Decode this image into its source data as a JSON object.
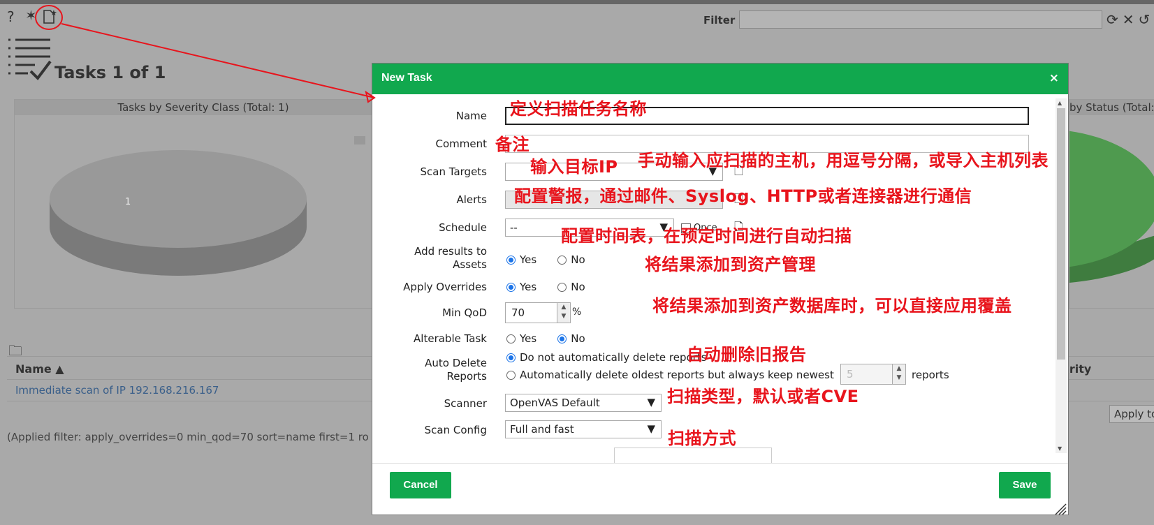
{
  "toolbar": {
    "help_icon": "help-icon",
    "wizard_icon": "wizard-icon",
    "new_task_icon": "new-task-icon"
  },
  "filter": {
    "label": "Filter",
    "value": ""
  },
  "page": {
    "title": "Tasks 1 of 1"
  },
  "charts": {
    "left_title": "Tasks by Severity Class (Total: 1)",
    "right_title": "by Status (Total:",
    "pie_label": "1"
  },
  "chart_data": [
    {
      "type": "pie",
      "title": "Tasks by Severity Class (Total: 1)",
      "categories": [
        ""
      ],
      "values": [
        1
      ]
    }
  ],
  "table": {
    "col_name": "Name ▲",
    "col_severity": "erity",
    "rows": [
      {
        "name": "Immediate scan of IP 192.168.216.167"
      }
    ],
    "apply_label": "Apply to"
  },
  "applied_filter": "(Applied filter: apply_overrides=0 min_qod=70 sort=name first=1 ro",
  "dialog": {
    "title": "New Task",
    "close": "×",
    "fields": {
      "name": "Name",
      "comment": "Comment",
      "scan_targets": "Scan Targets",
      "alerts": "Alerts",
      "schedule": "Schedule",
      "add_results_1": "Add results to",
      "add_results_2": "Assets",
      "apply_overrides": "Apply Overrides",
      "min_qod": "Min QoD",
      "alterable": "Alterable Task",
      "auto_delete_1": "Auto Delete",
      "auto_delete_2": "Reports",
      "scanner": "Scanner",
      "scan_config": "Scan Config"
    },
    "values": {
      "name": "",
      "comment": "",
      "scan_targets": "",
      "schedule": "--",
      "schedule_once": "Once",
      "min_qod": "70",
      "min_qod_unit": "%",
      "keep_newest": "5",
      "scanner": "OpenVAS Default",
      "scan_config": "Full and fast"
    },
    "radios": {
      "yes": "Yes",
      "no": "No",
      "auto_delete_none": "Do not automatically delete reports",
      "auto_delete_oldest": "Automatically delete oldest reports but always keep newest",
      "reports": "reports"
    },
    "cancel": "Cancel",
    "save": "Save"
  },
  "annotations": {
    "name": "定义扫描任务名称",
    "comment": "备注",
    "target_ip": "输入目标IP",
    "target_hosts": "手动输入应扫描的主机，用逗号分隔，或导入主机列表",
    "alerts": "配置警报，通过邮件、Syslog、HTTP或者连接器进行通信",
    "schedule": "配置时间表，在预定时间进行自动扫描",
    "assets": "将结果添加到资产管理",
    "overrides": "将结果添加到资产数据库时，可以直接应用覆盖",
    "auto_delete": "自动删除旧报告",
    "scanner": "扫描类型，默认或者CVE",
    "scan_config": "扫描方式"
  },
  "colors": {
    "accent_green": "#11a84e",
    "annotation_red": "#e8141c"
  }
}
